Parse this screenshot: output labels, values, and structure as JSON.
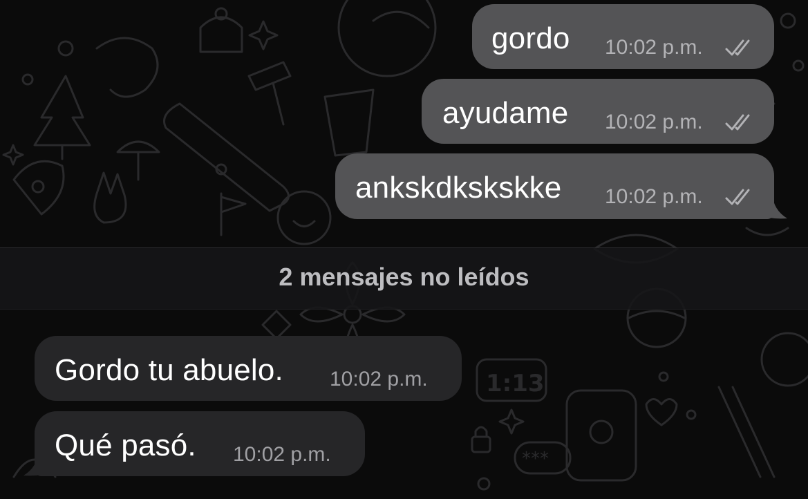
{
  "messages_outgoing": [
    {
      "text": "gordo",
      "time": "10:02 p.m.",
      "status": "read-double-check-icon"
    },
    {
      "text": "ayudame",
      "time": "10:02 p.m.",
      "status": "read-double-check-icon"
    },
    {
      "text": "ankskdkskskke",
      "time": "10:02 p.m.",
      "status": "read-double-check-icon"
    }
  ],
  "unread_divider": "2 mensajes no leídos",
  "messages_incoming": [
    {
      "text": "Gordo tu abuelo.",
      "time": "10:02 p.m."
    },
    {
      "text": "Qué pasó.",
      "time": "10:02 p.m."
    }
  ],
  "colors": {
    "background": "#0b0b0b",
    "outgoing_bubble": "#545456",
    "incoming_bubble": "#262628",
    "timestamp": "#b3b3b6",
    "divider_text": "#bdbdc0"
  }
}
